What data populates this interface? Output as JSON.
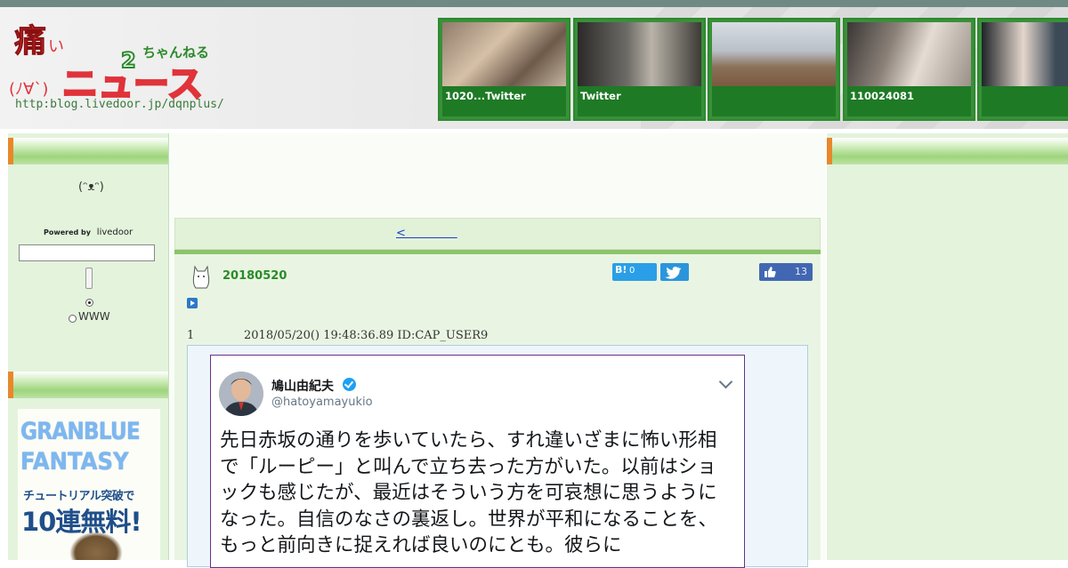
{
  "site": {
    "logo_text": "痛いニュース",
    "logo_kana": "ちゃんねる",
    "logo_face": "(ﾉ∀`)",
    "url": "http:blog.livedoor.jp/dqnplus/"
  },
  "header_thumbs": [
    {
      "caption": "1020...Twitter"
    },
    {
      "caption": "Twitter"
    },
    {
      "caption": ""
    },
    {
      "caption": "110024081"
    },
    {
      "caption": ""
    }
  ],
  "sidebar": {
    "face": "(ᵔᴥᵔ)",
    "powered_by": "Powered by",
    "livedoor": "livedoor",
    "radio_www": "WWW",
    "banner": {
      "line1": "GRANBLUE",
      "line2": "FANTASY",
      "line3": "チュートリアル突破で",
      "line4": "10連無料!"
    }
  },
  "nav": {
    "prev_link": "<              "
  },
  "article": {
    "date": "20180520",
    "hatena_label": "B!",
    "hatena_count": "0",
    "fb_count": "13",
    "post_number": "1",
    "post_meta": "2018/05/20() 19:48:36.89 ID:CAP_USER9"
  },
  "tweet": {
    "name": "鳩山由紀夫",
    "handle": "@hatoyamayukio",
    "text": "先日赤坂の通りを歩いていたら、すれ違いざまに怖い形相で「ルーピー」と叫んで立ち去った方がいた。以前はショックも感じたが、最近はそういう方を可哀想に思うようになった。自信のなさの裏返し。世界が平和になることを、もっと前向きに捉えれば良いのにとも。彼らに"
  },
  "colors": {
    "accent_green": "#2a8a2a",
    "sidebar_bg": "#e3f3dc",
    "twitter_blue": "#1da1f2",
    "facebook_blue": "#4267b2",
    "link_blue": "#1a3fd0"
  }
}
